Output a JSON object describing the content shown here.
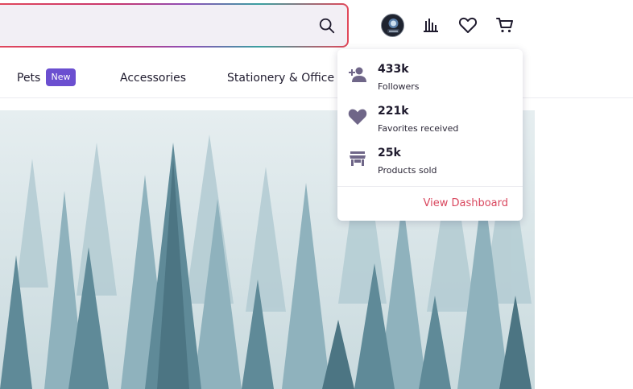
{
  "search": {
    "value": "",
    "placeholder": ""
  },
  "header": {
    "avatar_icon": "user-avatar",
    "stats_icon": "bar-chart-icon",
    "favorites_icon": "heart-icon",
    "cart_icon": "cart-icon"
  },
  "nav": {
    "items": [
      {
        "label": "Pets",
        "badge": "New"
      },
      {
        "label": "Accessories"
      },
      {
        "label": "Stationery & Office"
      }
    ]
  },
  "popover": {
    "stats": [
      {
        "icon": "add-person-icon",
        "value": "433k",
        "label": "Followers"
      },
      {
        "icon": "heart-icon",
        "value": "221k",
        "label": "Favorites received"
      },
      {
        "icon": "store-icon",
        "value": "25k",
        "label": "Products sold"
      }
    ],
    "dashboard_link": "View Dashboard"
  },
  "colors": {
    "accent": "#6b4fd0",
    "link": "#d9475e",
    "icon": "#6f6688"
  }
}
